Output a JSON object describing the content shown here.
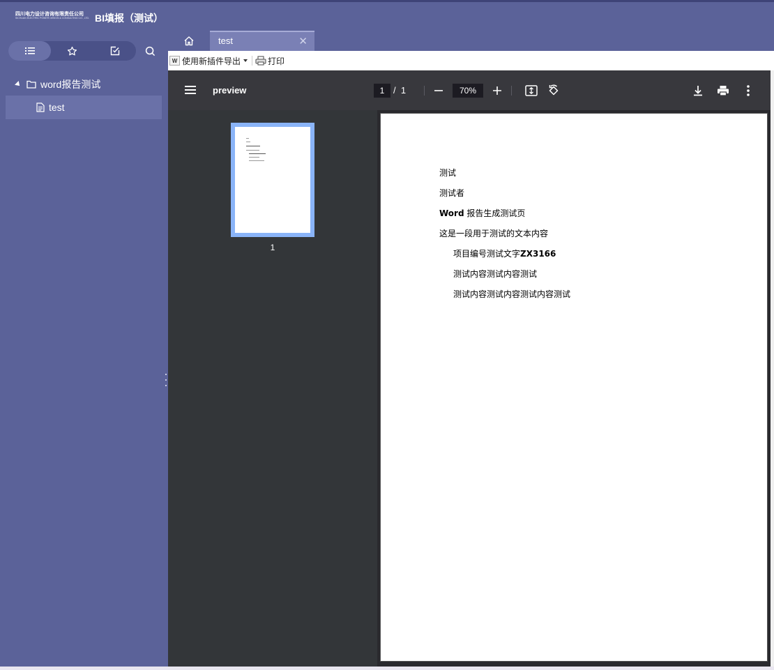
{
  "header": {
    "logo_text": "四川电力设计咨询有限责任公司",
    "logo_subtext": "SICHUAN ELECTRIC POWER DESIGN & CONSULTING CO., LTD.",
    "app_title": "BI填报（测试）"
  },
  "sidebar": {
    "tabs": [
      {
        "icon": "list-icon",
        "active": true
      },
      {
        "icon": "star-icon",
        "active": false
      },
      {
        "icon": "edit-check-icon",
        "active": false
      }
    ],
    "search_icon": "search-icon",
    "tree": {
      "folder_label": "word报告测试",
      "item_label": "test"
    }
  },
  "tabs": {
    "home_icon": "home-icon",
    "active_tab": "test",
    "close_glyph": "✕"
  },
  "toolbar": {
    "export_label": "使用新插件导出",
    "word_icon_text": "W",
    "print_label": "打印"
  },
  "viewer": {
    "title": "preview",
    "page_current": "1",
    "page_sep": "/",
    "page_total": "1",
    "zoom": "70%",
    "thumb_page_number": "1",
    "lines": [
      {
        "text": "测试",
        "bold": false
      },
      {
        "text": "测试者",
        "bold": false
      },
      {
        "prefix": "Word",
        "text": " 报告生成测试页",
        "bold": false
      },
      {
        "text": "这是一段用于测试的文本内容",
        "bold": false
      },
      {
        "text": "项目编号测试文字",
        "suffix": "ZX3166",
        "bold": false
      },
      {
        "text": "测试内容测试内容测试",
        "bold": false
      },
      {
        "text": "测试内容测试内容测试内容测试",
        "bold": false
      }
    ]
  },
  "colors": {
    "header_bg": "#5b6299",
    "active_item": "#6a71a8",
    "viewer_toolbar": "#38383d",
    "thumb_border": "#8ab4f8"
  }
}
